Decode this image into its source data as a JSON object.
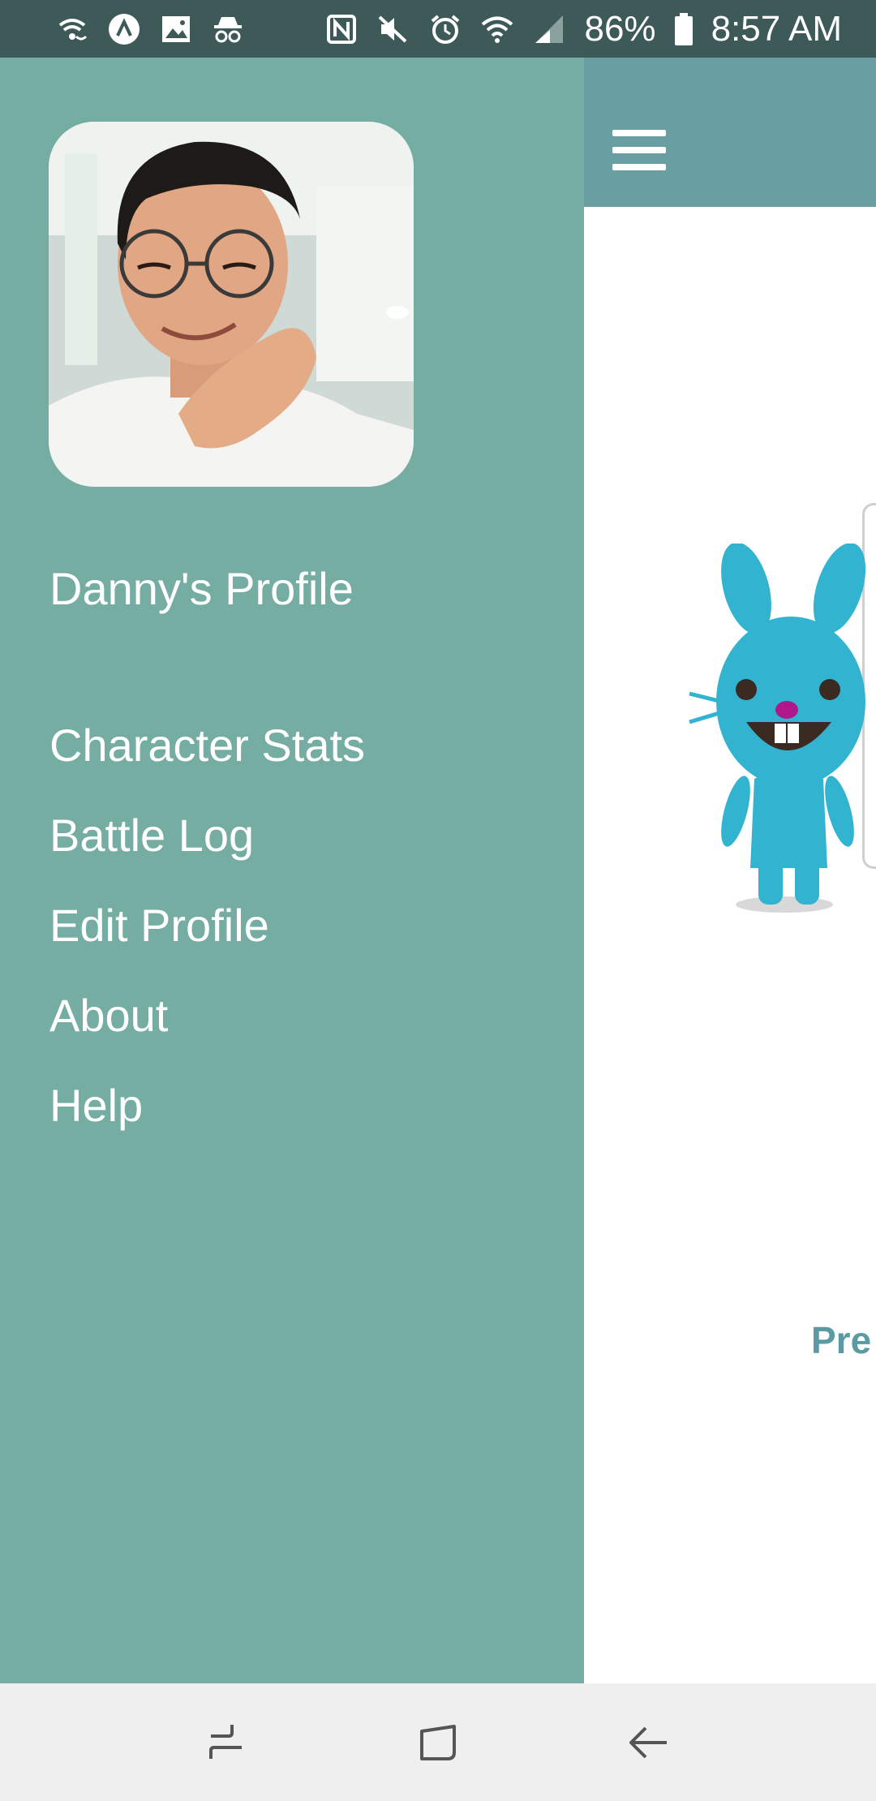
{
  "status_bar": {
    "battery": "86%",
    "time": "8:57 AM",
    "left_icons": [
      "wifi-call-icon",
      "arrow-up-badge-icon",
      "image-icon",
      "incognito-icon"
    ],
    "right_icons": [
      "nfc-icon",
      "mute-icon",
      "alarm-icon",
      "wifi-icon",
      "signal-icon",
      "battery-icon"
    ]
  },
  "drawer": {
    "profile_title": "Danny's Profile",
    "items": [
      {
        "label": "Character Stats"
      },
      {
        "label": "Battle Log"
      },
      {
        "label": "Edit Profile"
      },
      {
        "label": "About"
      },
      {
        "label": "Help"
      }
    ]
  },
  "background": {
    "partial_text": "Pre",
    "menu_icon": "hamburger-menu-icon"
  },
  "nav_bar": {
    "icons": [
      "recent-apps-icon",
      "home-icon",
      "back-icon"
    ]
  },
  "colors": {
    "status_bar": "#3d5a59",
    "app_bar": "#6a9fa1",
    "drawer": "#75ada3",
    "nav_bar": "#efefef",
    "accent_text": "#5b9aa3"
  }
}
